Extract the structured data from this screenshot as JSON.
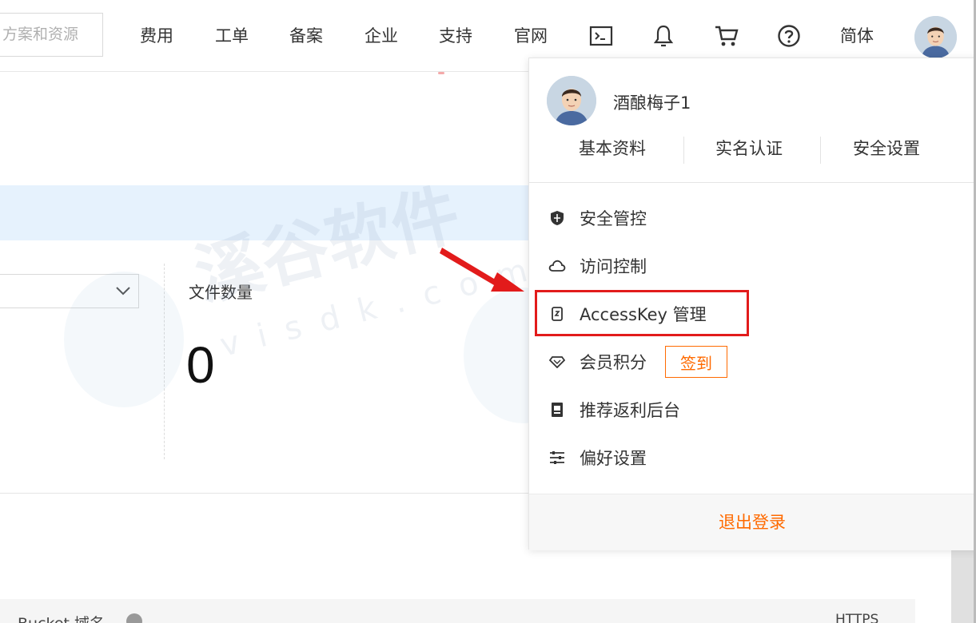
{
  "topbar": {
    "search_placeholder": "方案和资源",
    "nav": [
      "费用",
      "工单",
      "备案",
      "企业",
      "支持",
      "官网"
    ],
    "icons": [
      "terminal-icon",
      "bell-icon",
      "cart-icon",
      "help-icon"
    ],
    "language": "简体"
  },
  "main": {
    "file_count_label": "文件数量",
    "file_count_value": "0",
    "bucket_domain_label": "Bucket 域名",
    "https_label": "HTTPS"
  },
  "watermark": {
    "text": "溪谷软件",
    "url": "visdk.com"
  },
  "dropdown": {
    "username": "酒酿梅子1",
    "links": [
      "基本资料",
      "实名认证",
      "安全设置"
    ],
    "menu": [
      {
        "label": "安全管控",
        "icon": "shield-icon"
      },
      {
        "label": "访问控制",
        "icon": "cloud-icon"
      },
      {
        "label": "AccessKey 管理",
        "icon": "key-icon"
      },
      {
        "label": "会员积分",
        "icon": "diamond-icon"
      },
      {
        "label": "推荐返利后台",
        "icon": "document-icon"
      },
      {
        "label": "偏好设置",
        "icon": "sliders-icon"
      }
    ],
    "signin_label": "签到",
    "logout_label": "退出登录"
  },
  "colors": {
    "accent_orange": "#ff6a00",
    "highlight_red": "#e21b1b",
    "band_blue": "#e6f2fd"
  }
}
